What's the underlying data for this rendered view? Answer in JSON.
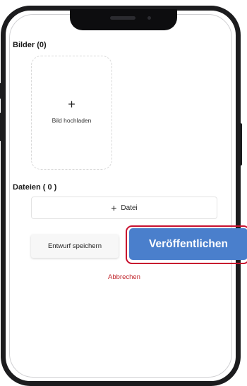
{
  "colors": {
    "accent": "#4a7fcc",
    "danger": "#c0272d",
    "highlight": "#c8102e"
  },
  "images": {
    "heading": "Bilder (0)",
    "upload_icon": "plus-icon",
    "upload_symbol": "+",
    "upload_label": "Bild hochladen"
  },
  "files": {
    "heading": "Dateien ( 0 )",
    "add_symbol": "+",
    "add_label": "Datei"
  },
  "actions": {
    "save_draft_label": "Entwurf speichern",
    "publish_label": "Veröffentlichen",
    "cancel_label": "Abbrechen"
  }
}
